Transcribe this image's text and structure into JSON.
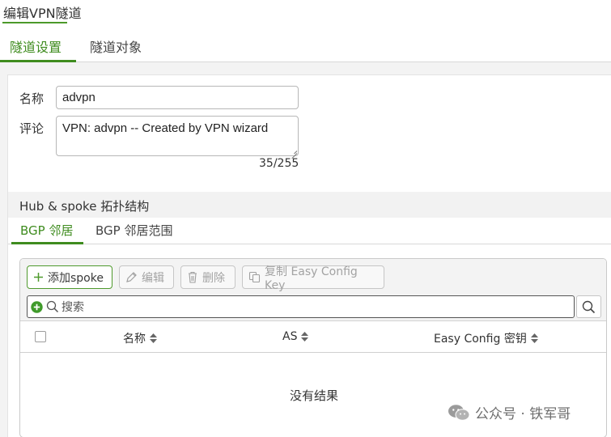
{
  "window": {
    "title": "编辑VPN隧道"
  },
  "tabs": [
    {
      "label": "隧道设置",
      "active": true
    },
    {
      "label": "隧道对象",
      "active": false
    }
  ],
  "form": {
    "name_label": "名称",
    "name_value": "advpn",
    "comment_label": "评论",
    "comment_value": "VPN: advpn -- Created by VPN wizard",
    "comment_counter": "35/255"
  },
  "section": {
    "title": "Hub & spoke 拓扑结构"
  },
  "subtabs": [
    {
      "label": "BGP 邻居",
      "active": true
    },
    {
      "label": "BGP 邻居范围",
      "active": false
    }
  ],
  "toolbar": {
    "add_label": "添加spoke",
    "edit_label": "编辑",
    "delete_label": "删除",
    "copy_label": "复制 Easy Config Key"
  },
  "search": {
    "placeholder": "搜索",
    "value": ""
  },
  "table": {
    "columns": [
      "名称",
      "AS",
      "Easy Config 密钥"
    ],
    "rows": [],
    "empty_text": "没有结果"
  },
  "watermark": {
    "text": "公众号 · 铁军哥"
  },
  "colors": {
    "accent": "#3f8c1f",
    "border": "#c9c9c9",
    "background": "#f3f3f3"
  },
  "icons": [
    "plus-icon",
    "edit-icon",
    "trash-icon",
    "copy-icon",
    "add-circle-icon",
    "search-icon",
    "sort-icon",
    "wechat-icon"
  ]
}
